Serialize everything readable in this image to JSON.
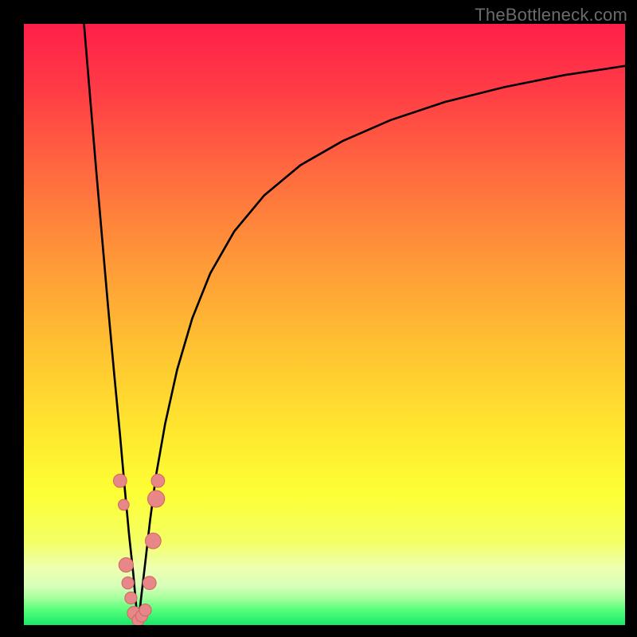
{
  "watermark": "TheBottleneck.com",
  "colors": {
    "frame": "#000000",
    "curve": "#000000",
    "marker_fill": "#e88787",
    "marker_stroke": "#d46868",
    "gradient_stops": [
      {
        "offset": 0.0,
        "color": "#ff1f49"
      },
      {
        "offset": 0.1,
        "color": "#ff3946"
      },
      {
        "offset": 0.25,
        "color": "#ff6b3f"
      },
      {
        "offset": 0.4,
        "color": "#ff9a38"
      },
      {
        "offset": 0.55,
        "color": "#ffc531"
      },
      {
        "offset": 0.68,
        "color": "#ffe82f"
      },
      {
        "offset": 0.78,
        "color": "#fdff34"
      },
      {
        "offset": 0.86,
        "color": "#f4ff63"
      },
      {
        "offset": 0.905,
        "color": "#eeffb0"
      },
      {
        "offset": 0.935,
        "color": "#d7ffb9"
      },
      {
        "offset": 0.955,
        "color": "#a6ff9d"
      },
      {
        "offset": 0.975,
        "color": "#55ff79"
      },
      {
        "offset": 1.0,
        "color": "#19e86a"
      }
    ]
  },
  "chart_data": {
    "type": "line",
    "title": "",
    "xlabel": "",
    "ylabel": "",
    "xlim": [
      0,
      100
    ],
    "ylim": [
      0,
      100
    ],
    "notch_x": 19,
    "series": [
      {
        "name": "left-branch",
        "x": [
          10.0,
          11.0,
          12.0,
          13.0,
          14.0,
          15.0,
          16.0,
          16.8,
          17.5,
          18.2,
          18.6,
          19.0
        ],
        "y": [
          100.0,
          88.0,
          76.0,
          64.5,
          53.0,
          42.0,
          31.5,
          22.5,
          15.0,
          8.5,
          4.0,
          0.0
        ]
      },
      {
        "name": "right-branch",
        "x": [
          19.0,
          19.5,
          20.2,
          21.0,
          22.0,
          23.5,
          25.5,
          28.0,
          31.0,
          35.0,
          40.0,
          46.0,
          53.0,
          61.0,
          70.0,
          80.0,
          90.0,
          100.0
        ],
        "y": [
          0.0,
          4.5,
          10.5,
          17.5,
          25.0,
          33.5,
          42.5,
          51.0,
          58.5,
          65.5,
          71.5,
          76.5,
          80.5,
          84.0,
          87.0,
          89.5,
          91.5,
          93.0
        ]
      }
    ],
    "markers": [
      {
        "x": 16.0,
        "y": 24.0,
        "r": 1.1
      },
      {
        "x": 16.6,
        "y": 20.0,
        "r": 0.9
      },
      {
        "x": 17.0,
        "y": 10.0,
        "r": 1.2
      },
      {
        "x": 17.3,
        "y": 7.0,
        "r": 1.0
      },
      {
        "x": 17.8,
        "y": 4.5,
        "r": 1.0
      },
      {
        "x": 18.3,
        "y": 2.0,
        "r": 1.1
      },
      {
        "x": 19.0,
        "y": 0.8,
        "r": 1.0
      },
      {
        "x": 19.6,
        "y": 1.5,
        "r": 1.0
      },
      {
        "x": 20.2,
        "y": 2.5,
        "r": 1.0
      },
      {
        "x": 20.9,
        "y": 7.0,
        "r": 1.1
      },
      {
        "x": 21.5,
        "y": 14.0,
        "r": 1.3
      },
      {
        "x": 22.0,
        "y": 21.0,
        "r": 1.4
      },
      {
        "x": 22.3,
        "y": 24.0,
        "r": 1.1
      }
    ]
  }
}
